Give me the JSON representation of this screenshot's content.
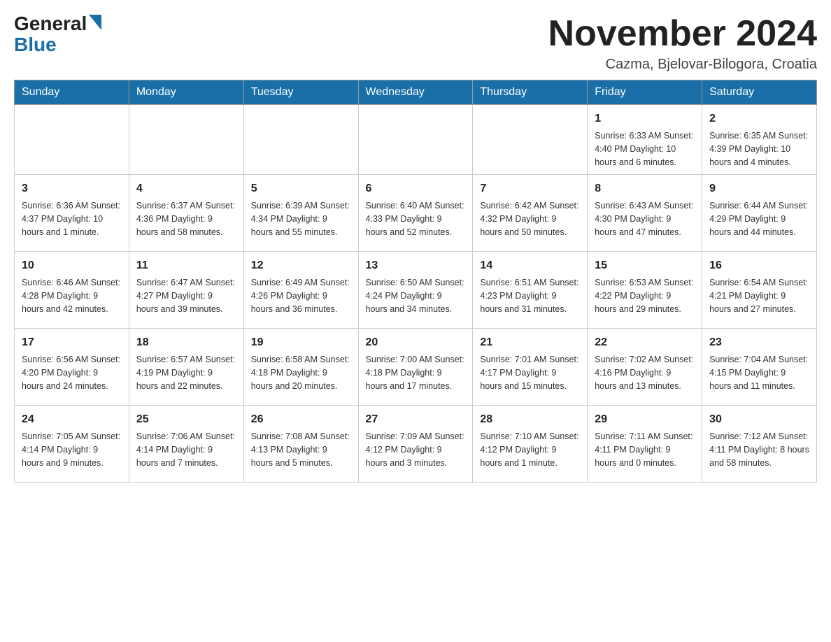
{
  "logo": {
    "general": "General",
    "blue": "Blue"
  },
  "header": {
    "title": "November 2024",
    "subtitle": "Cazma, Bjelovar-Bilogora, Croatia"
  },
  "weekdays": [
    "Sunday",
    "Monday",
    "Tuesday",
    "Wednesday",
    "Thursday",
    "Friday",
    "Saturday"
  ],
  "weeks": [
    [
      {
        "day": "",
        "info": ""
      },
      {
        "day": "",
        "info": ""
      },
      {
        "day": "",
        "info": ""
      },
      {
        "day": "",
        "info": ""
      },
      {
        "day": "",
        "info": ""
      },
      {
        "day": "1",
        "info": "Sunrise: 6:33 AM\nSunset: 4:40 PM\nDaylight: 10 hours and 6 minutes."
      },
      {
        "day": "2",
        "info": "Sunrise: 6:35 AM\nSunset: 4:39 PM\nDaylight: 10 hours and 4 minutes."
      }
    ],
    [
      {
        "day": "3",
        "info": "Sunrise: 6:36 AM\nSunset: 4:37 PM\nDaylight: 10 hours and 1 minute."
      },
      {
        "day": "4",
        "info": "Sunrise: 6:37 AM\nSunset: 4:36 PM\nDaylight: 9 hours and 58 minutes."
      },
      {
        "day": "5",
        "info": "Sunrise: 6:39 AM\nSunset: 4:34 PM\nDaylight: 9 hours and 55 minutes."
      },
      {
        "day": "6",
        "info": "Sunrise: 6:40 AM\nSunset: 4:33 PM\nDaylight: 9 hours and 52 minutes."
      },
      {
        "day": "7",
        "info": "Sunrise: 6:42 AM\nSunset: 4:32 PM\nDaylight: 9 hours and 50 minutes."
      },
      {
        "day": "8",
        "info": "Sunrise: 6:43 AM\nSunset: 4:30 PM\nDaylight: 9 hours and 47 minutes."
      },
      {
        "day": "9",
        "info": "Sunrise: 6:44 AM\nSunset: 4:29 PM\nDaylight: 9 hours and 44 minutes."
      }
    ],
    [
      {
        "day": "10",
        "info": "Sunrise: 6:46 AM\nSunset: 4:28 PM\nDaylight: 9 hours and 42 minutes."
      },
      {
        "day": "11",
        "info": "Sunrise: 6:47 AM\nSunset: 4:27 PM\nDaylight: 9 hours and 39 minutes."
      },
      {
        "day": "12",
        "info": "Sunrise: 6:49 AM\nSunset: 4:26 PM\nDaylight: 9 hours and 36 minutes."
      },
      {
        "day": "13",
        "info": "Sunrise: 6:50 AM\nSunset: 4:24 PM\nDaylight: 9 hours and 34 minutes."
      },
      {
        "day": "14",
        "info": "Sunrise: 6:51 AM\nSunset: 4:23 PM\nDaylight: 9 hours and 31 minutes."
      },
      {
        "day": "15",
        "info": "Sunrise: 6:53 AM\nSunset: 4:22 PM\nDaylight: 9 hours and 29 minutes."
      },
      {
        "day": "16",
        "info": "Sunrise: 6:54 AM\nSunset: 4:21 PM\nDaylight: 9 hours and 27 minutes."
      }
    ],
    [
      {
        "day": "17",
        "info": "Sunrise: 6:56 AM\nSunset: 4:20 PM\nDaylight: 9 hours and 24 minutes."
      },
      {
        "day": "18",
        "info": "Sunrise: 6:57 AM\nSunset: 4:19 PM\nDaylight: 9 hours and 22 minutes."
      },
      {
        "day": "19",
        "info": "Sunrise: 6:58 AM\nSunset: 4:18 PM\nDaylight: 9 hours and 20 minutes."
      },
      {
        "day": "20",
        "info": "Sunrise: 7:00 AM\nSunset: 4:18 PM\nDaylight: 9 hours and 17 minutes."
      },
      {
        "day": "21",
        "info": "Sunrise: 7:01 AM\nSunset: 4:17 PM\nDaylight: 9 hours and 15 minutes."
      },
      {
        "day": "22",
        "info": "Sunrise: 7:02 AM\nSunset: 4:16 PM\nDaylight: 9 hours and 13 minutes."
      },
      {
        "day": "23",
        "info": "Sunrise: 7:04 AM\nSunset: 4:15 PM\nDaylight: 9 hours and 11 minutes."
      }
    ],
    [
      {
        "day": "24",
        "info": "Sunrise: 7:05 AM\nSunset: 4:14 PM\nDaylight: 9 hours and 9 minutes."
      },
      {
        "day": "25",
        "info": "Sunrise: 7:06 AM\nSunset: 4:14 PM\nDaylight: 9 hours and 7 minutes."
      },
      {
        "day": "26",
        "info": "Sunrise: 7:08 AM\nSunset: 4:13 PM\nDaylight: 9 hours and 5 minutes."
      },
      {
        "day": "27",
        "info": "Sunrise: 7:09 AM\nSunset: 4:12 PM\nDaylight: 9 hours and 3 minutes."
      },
      {
        "day": "28",
        "info": "Sunrise: 7:10 AM\nSunset: 4:12 PM\nDaylight: 9 hours and 1 minute."
      },
      {
        "day": "29",
        "info": "Sunrise: 7:11 AM\nSunset: 4:11 PM\nDaylight: 9 hours and 0 minutes."
      },
      {
        "day": "30",
        "info": "Sunrise: 7:12 AM\nSunset: 4:11 PM\nDaylight: 8 hours and 58 minutes."
      }
    ]
  ]
}
